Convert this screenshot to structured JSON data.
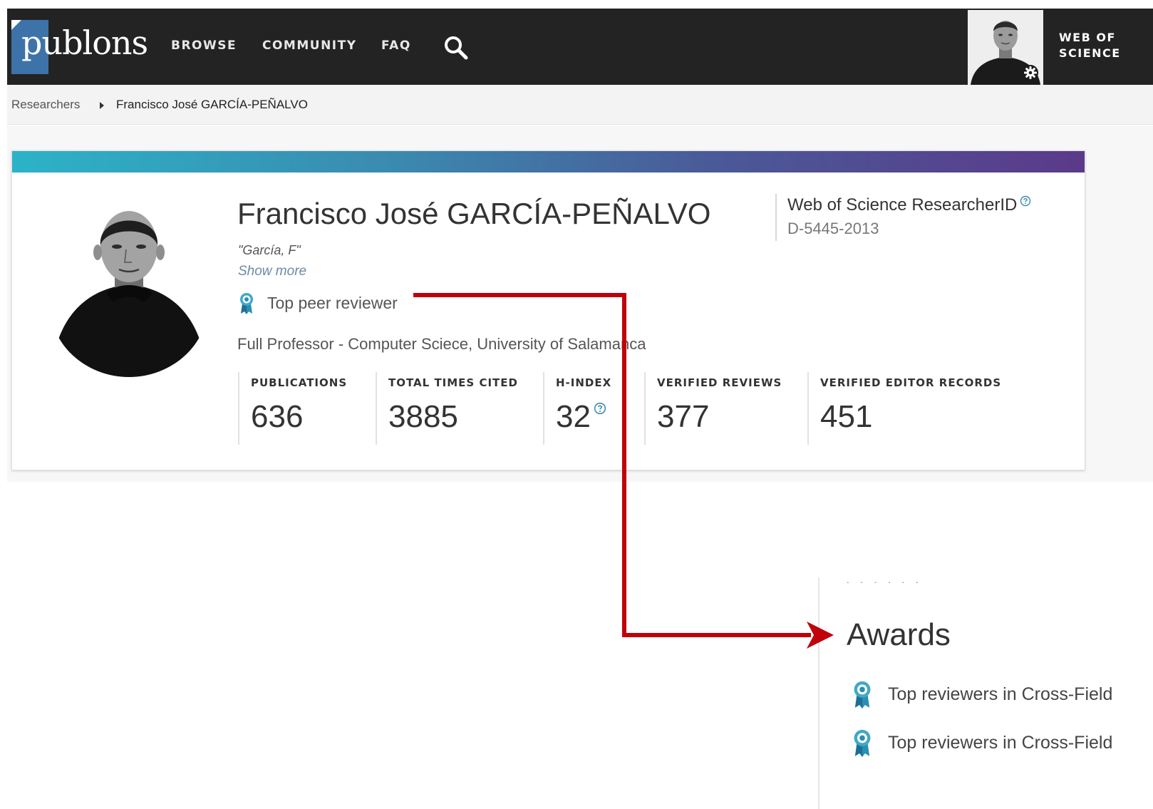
{
  "nav": {
    "logo": "publons",
    "links": [
      "BROWSE",
      "COMMUNITY",
      "FAQ"
    ],
    "wos_label": "WEB OF\nSCIENCE"
  },
  "breadcrumb": {
    "parent": "Researchers",
    "current": "Francisco José GARCÍA-PEÑALVO"
  },
  "profile": {
    "name": "Francisco José GARCÍA-PEÑALVO",
    "alias": "\"García, F\"",
    "show_more": "Show more",
    "badge": "Top peer reviewer",
    "position": "Full Professor - Computer Sciece, University of Salamanca",
    "researcher_id_title": "Web of Science ResearcherID",
    "researcher_id": "D-5445-2013"
  },
  "stats": [
    {
      "label": "PUBLICATIONS",
      "value": "636"
    },
    {
      "label": "TOTAL TIMES CITED",
      "value": "3885"
    },
    {
      "label": "H-INDEX",
      "value": "32"
    },
    {
      "label": "VERIFIED REVIEWS",
      "value": "377"
    },
    {
      "label": "VERIFIED EDITOR RECORDS",
      "value": "451"
    }
  ],
  "awards": {
    "title": "Awards",
    "items": [
      "Top reviewers in Cross-Field",
      "Top reviewers in Cross-Field"
    ]
  },
  "colors": {
    "nav_bg": "#232323",
    "accent_blue": "#3d73a8",
    "badge_teal": "#2a8fb0",
    "annotation_red": "#c0000a"
  }
}
